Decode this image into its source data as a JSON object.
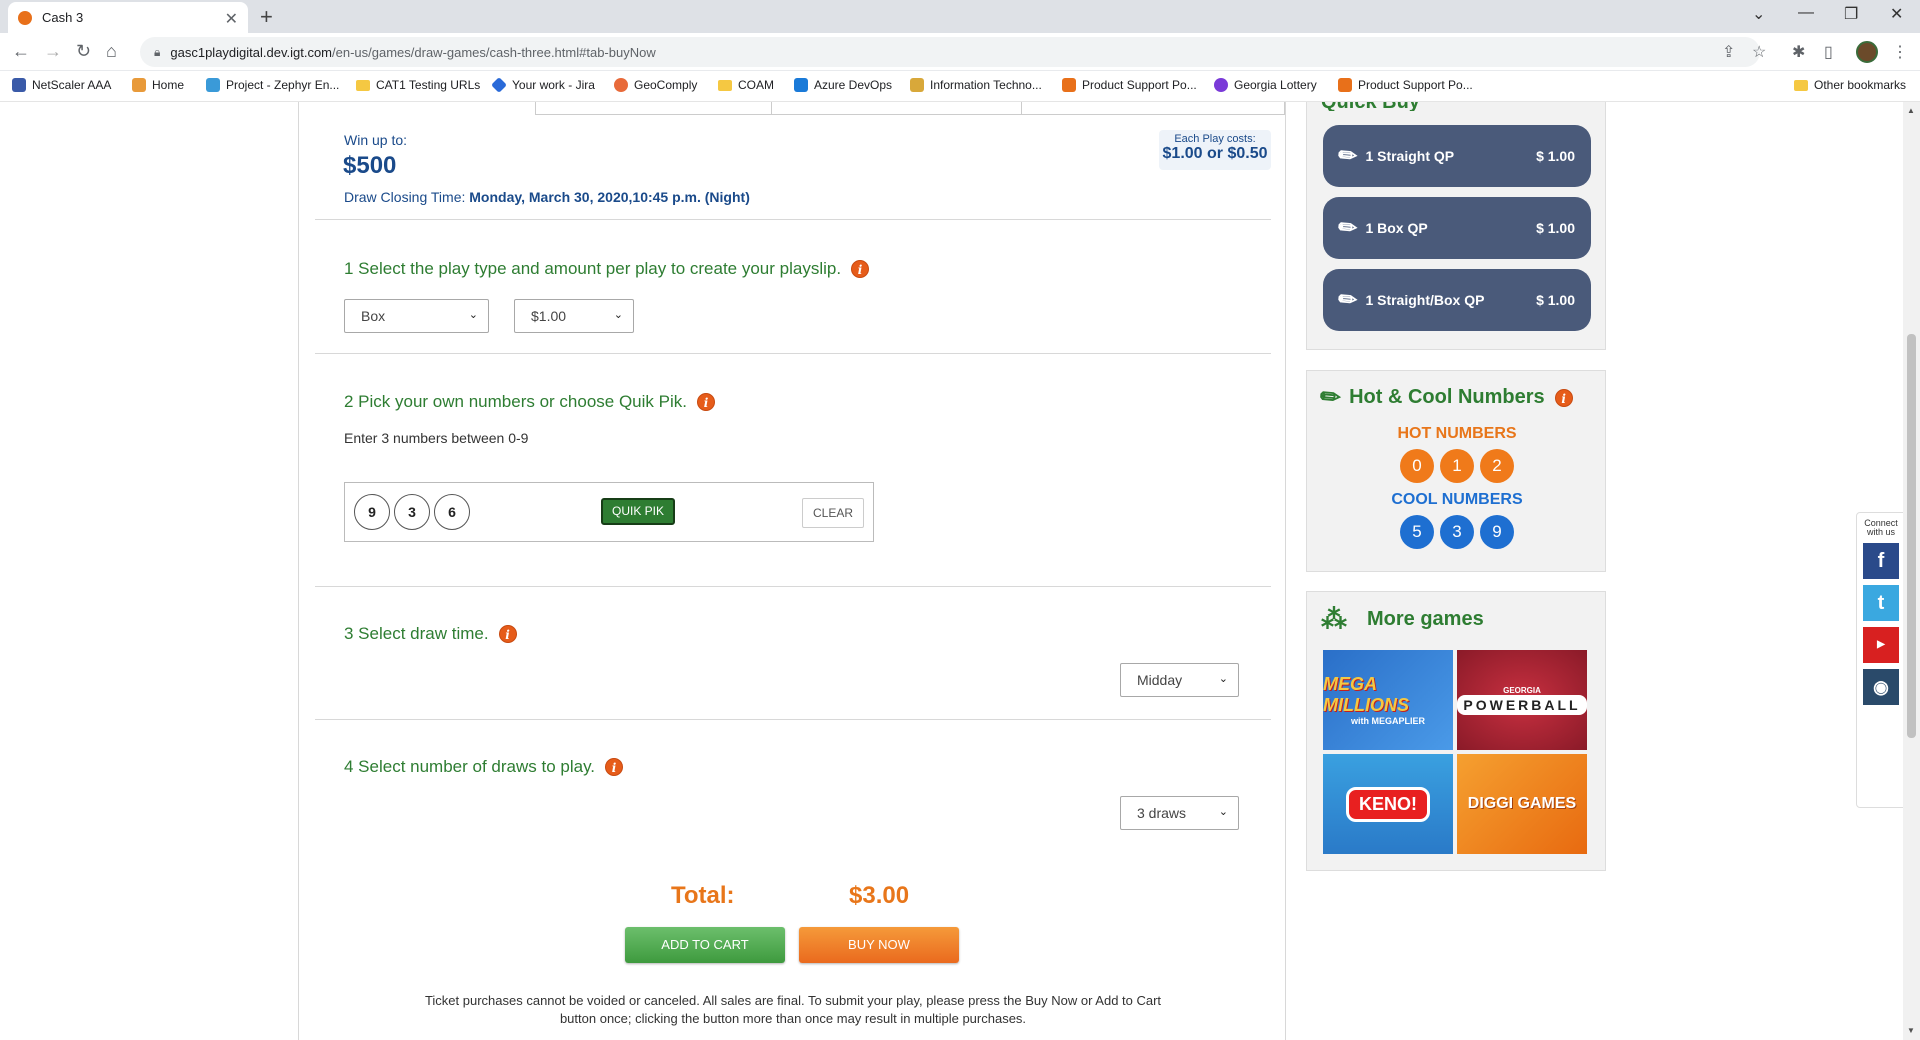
{
  "browser": {
    "tab_title": "Cash 3",
    "url_host": "gasc1playdigital.dev.igt.com",
    "url_path": "/en-us/games/draw-games/cash-three.html#tab-buyNow",
    "bookmarks": [
      "NetScaler AAA",
      "Home",
      "Project - Zephyr En...",
      "CAT1 Testing URLs",
      "Your work - Jira",
      "GeoComply",
      "COAM",
      "Azure DevOps",
      "Information Techno...",
      "Product Support Po...",
      "Georgia Lottery",
      "Product Support Po..."
    ],
    "other_bookmarks": "Other bookmarks"
  },
  "prize": {
    "win_label": "Win up to:",
    "win_amount": "$500",
    "closing_label": "Draw Closing Time:",
    "closing_time": "Monday, March 30, 2020,10:45 p.m. (Night)",
    "cost_label": "Each Play costs:",
    "cost_value": "$1.00 or $0.50"
  },
  "step1": {
    "title": "1 Select the play type and amount per play to create your playslip.",
    "play_type": "Box",
    "amount": "$1.00"
  },
  "step2": {
    "title": "2 Pick your own numbers or choose Quik Pik.",
    "hint": "Enter 3 numbers between 0-9",
    "numbers": [
      "9",
      "3",
      "6"
    ],
    "quikpik_label": "QUIK PIK",
    "clear_label": "CLEAR"
  },
  "step3": {
    "title": "3 Select draw time.",
    "draw_time": "Midday"
  },
  "step4": {
    "title": "4 Select number of draws to play.",
    "draws": "3 draws"
  },
  "checkout": {
    "total_label": "Total:",
    "total_value": "$3.00",
    "add_to_cart": "ADD TO CART",
    "buy_now": "BUY NOW",
    "disclaimer_line1": "Ticket purchases cannot be voided or canceled. All sales are final. To submit your play, please press the Buy Now or Add to Cart",
    "disclaimer_line2": "button once; clicking the button more than once may result in multiple purchases."
  },
  "quick_buy": {
    "header": "Quick Buy",
    "items": [
      {
        "label": "1 Straight QP",
        "amount": "$ 1.00"
      },
      {
        "label": "1 Box QP",
        "amount": "$ 1.00"
      },
      {
        "label": "1 Straight/Box QP",
        "amount": "$ 1.00"
      }
    ]
  },
  "hot_cool": {
    "title": "Hot & Cool Numbers",
    "hot_label": "HOT NUMBERS",
    "hot": [
      "0",
      "1",
      "2"
    ],
    "cool_label": "COOL NUMBERS",
    "cool": [
      "5",
      "3",
      "9"
    ]
  },
  "more_games": {
    "title": "More games",
    "games": [
      "MEGA MILLIONS",
      "POWERBALL",
      "KENO!",
      "DIGGI GAMES"
    ],
    "games_sub": [
      "with MEGAPLIER",
      "GEORGIA",
      "",
      "GAMES"
    ]
  },
  "social": {
    "label": "Connect with us"
  },
  "colors": {
    "green": "#2e7d32",
    "blue": "#1a4a8a",
    "orange": "#e8761a",
    "quick_buy_button": "#4a5a7a"
  }
}
